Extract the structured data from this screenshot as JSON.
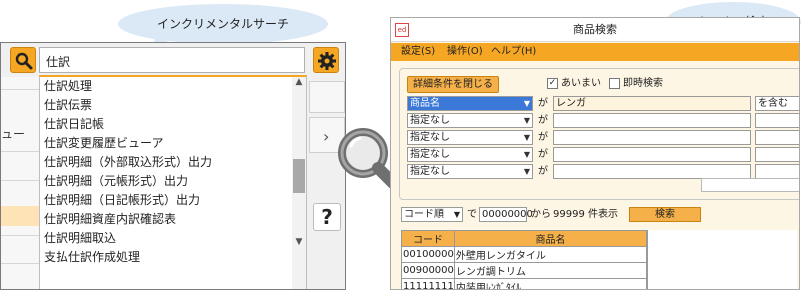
{
  "callouts": {
    "incremental": "インクリメンタルサーチ",
    "fuzzy": "あいまい検索"
  },
  "left_panel": {
    "search_value": "仕訳",
    "side_fragment": "ュー",
    "suggestions": [
      "仕訳処理",
      "仕訳伝票",
      "仕訳日記帳",
      "仕訳変更履歴ビューア",
      "仕訳明細（外部取込形式）出力",
      "仕訳明細（元帳形式）出力",
      "仕訳明細（日記帳形式）出力",
      "仕訳明細資産内訳確認表",
      "仕訳明細取込",
      "支払仕訳作成処理"
    ],
    "more_glyph": "»",
    "help_glyph": "?",
    "chevron_glyph": "›"
  },
  "window": {
    "icon_label": "ed",
    "title": "商品検索",
    "menu": [
      "設定(S)",
      "操作(O)",
      "ヘルプ(H)"
    ],
    "detail_button": "詳細条件を閉じる",
    "fuzzy_checkbox": {
      "label": "あいまい",
      "checked": true
    },
    "instant_checkbox": {
      "label": "即時検索",
      "checked": false
    },
    "conditions": [
      {
        "field": "商品名",
        "particle": "が",
        "value": "レンガ",
        "mode": "を含む"
      },
      {
        "field": "指定なし",
        "particle": "が",
        "value": "",
        "mode": ""
      },
      {
        "field": "指定なし",
        "particle": "が",
        "value": "",
        "mode": ""
      },
      {
        "field": "指定なし",
        "particle": "が",
        "value": "",
        "mode": ""
      },
      {
        "field": "指定なし",
        "particle": "が",
        "value": "",
        "mode": ""
      }
    ],
    "sort": "コード順",
    "sort_suffix": "で",
    "start_code": "00000000",
    "from_text": "から",
    "count_text": "99999 件表示",
    "search_button": "検索",
    "table": {
      "headers": [
        "コード",
        "商品名"
      ],
      "rows": [
        [
          "00100000",
          "外壁用レンガタイル"
        ],
        [
          "00900000",
          "レンガ調トリム"
        ],
        [
          "11111111",
          "内装用ﾚﾝｶﾞﾀｲﾙ"
        ]
      ]
    }
  }
}
